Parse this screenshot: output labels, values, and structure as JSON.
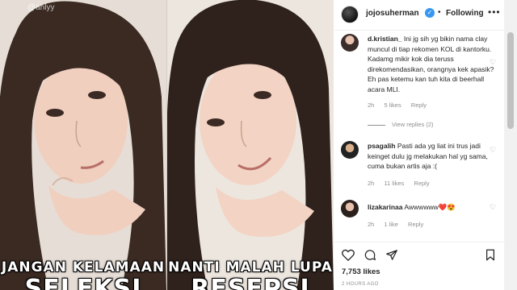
{
  "media": {
    "watermark": "@ahlyy",
    "left_caption": {
      "line1": "JANGAN KELAMAAN",
      "line2": "SELEKSI"
    },
    "right_caption": {
      "line1": "NANTI MALAH LUPA",
      "line2": "RESEPSI"
    }
  },
  "header": {
    "username": "jojosuherman",
    "separator": "•",
    "follow_label": "Following",
    "more_label": "•••"
  },
  "comments": [
    {
      "username": "d.kristian_",
      "text": "Ini jg sih yg bikin nama clay muncul di tiap rekomen KOL di kantorku. Kadamg mikir kok dia teruss direkomendasikan, orangnya kek apasik? Eh pas ketemu kan tuh kita di beerhall acara MLI.",
      "time": "2h",
      "likes": "5 likes",
      "reply": "Reply",
      "view_replies": "View replies (2)"
    },
    {
      "username": "psagalih",
      "text": "Pasti ada yg liat ini trus jadi keinget dulu jg melakukan hal yg sama, cuma bukan artis aja :(",
      "time": "2h",
      "likes": "11 likes",
      "reply": "Reply"
    },
    {
      "username": "lizakarinaa",
      "text": "Awwwwww",
      "emoji": "❤️😍",
      "time": "2h",
      "likes": "1 like",
      "reply": "Reply"
    }
  ],
  "footer": {
    "likes": "7,753 likes",
    "time_ago": "2 HOURS AGO"
  },
  "colors": {
    "verified": "#3897f0",
    "muted": "#8e8e8e",
    "text": "#262626"
  }
}
